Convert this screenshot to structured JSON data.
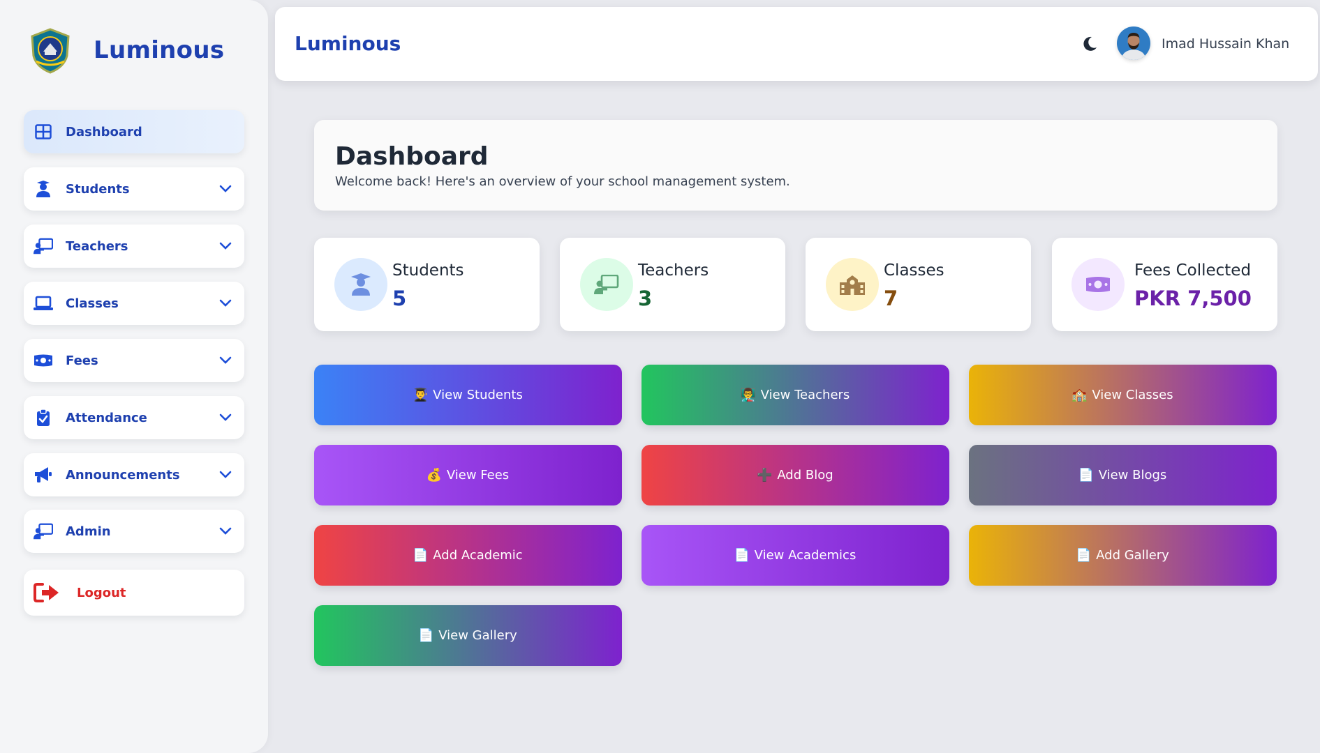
{
  "sidebar": {
    "brand_name": "Luminous",
    "items": [
      {
        "label": "Dashboard",
        "icon": "grid-icon"
      },
      {
        "label": "Students",
        "icon": "student-icon"
      },
      {
        "label": "Teachers",
        "icon": "teacher-icon"
      },
      {
        "label": "Classes",
        "icon": "laptop-icon"
      },
      {
        "label": "Fees",
        "icon": "money-icon"
      },
      {
        "label": "Attendance",
        "icon": "clipboard-check-icon"
      },
      {
        "label": "Announcements",
        "icon": "megaphone-icon"
      },
      {
        "label": "Admin",
        "icon": "teacher-icon"
      },
      {
        "label": "Logout",
        "icon": "logout-icon"
      }
    ]
  },
  "header": {
    "title": "Luminous",
    "user_name": "Imad Hussain Khan"
  },
  "main": {
    "title": "Dashboard",
    "subtitle": "Welcome back! Here's an overview of your school management system.",
    "stats": [
      {
        "label": "Students",
        "value": "5",
        "color": "#1e40af",
        "icon_bg": "#dbeafe",
        "icon": "graduate-icon"
      },
      {
        "label": "Teachers",
        "value": "3",
        "color": "#166534",
        "icon_bg": "#dcfce7",
        "icon": "chalkboard-teacher-icon"
      },
      {
        "label": "Classes",
        "value": "7",
        "color": "#854d0e",
        "icon_bg": "#fef3c7",
        "icon": "school-icon"
      },
      {
        "label": "Fees Collected",
        "value": "PKR 7,500",
        "color": "#6b21a8",
        "icon_bg": "#f3e8ff",
        "icon": "money-icon"
      }
    ],
    "actions": [
      {
        "label": "View Students",
        "emoji": "👨‍🎓"
      },
      {
        "label": "View Teachers",
        "emoji": "👨‍🏫"
      },
      {
        "label": "View Classes",
        "emoji": "🏫"
      },
      {
        "label": "View Fees",
        "emoji": "💰"
      },
      {
        "label": "Add Blog",
        "emoji": "➕"
      },
      {
        "label": "View Blogs",
        "emoji": "📄"
      },
      {
        "label": "Add Academic",
        "emoji": "📄"
      },
      {
        "label": "View Academics",
        "emoji": "📄"
      },
      {
        "label": "Add Gallery",
        "emoji": "📄"
      },
      {
        "label": "View Gallery",
        "emoji": "📄"
      }
    ]
  },
  "colors": {
    "brand": "#1e40af",
    "logout": "#dc2626",
    "purple_end": "#7e22ce"
  }
}
